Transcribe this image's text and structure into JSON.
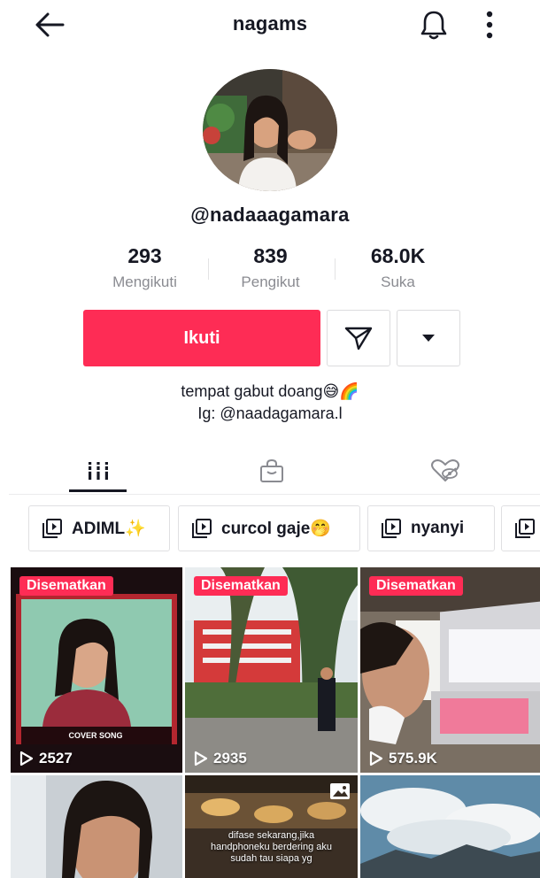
{
  "header": {
    "title": "nagams"
  },
  "profile": {
    "username": "@nadaaagamara",
    "stats": [
      {
        "value": "293",
        "label": "Mengikuti"
      },
      {
        "value": "839",
        "label": "Pengikut"
      },
      {
        "value": "68.0K",
        "label": "Suka"
      }
    ],
    "follow_label": "Ikuti",
    "bio_line1": "tempat gabut doang😅🌈",
    "bio_line2": "Ig: @naadagamara.l"
  },
  "playlists": [
    {
      "label": "ADIML✨"
    },
    {
      "label": "curcol gaje🤭"
    },
    {
      "label": "nyanyi"
    }
  ],
  "videos": [
    {
      "badge": "Disematkan",
      "views": "2527",
      "overlay": "COVER SONG"
    },
    {
      "badge": "Disematkan",
      "views": "2935"
    },
    {
      "badge": "Disematkan",
      "views": "575.9K"
    },
    {},
    {
      "caption": "difase sekarang,jika handphoneku berdering aku sudah tau siapa yg"
    },
    {}
  ],
  "colors": {
    "accent": "#fe2c55",
    "text": "#161823",
    "muted": "#8a8b91"
  },
  "icons": [
    "back-arrow-icon",
    "bell-icon",
    "more-vertical-icon",
    "send-icon",
    "caret-down-icon",
    "grid-icon",
    "shop-bag-icon",
    "liked-hidden-icon",
    "playlist-icon",
    "play-icon",
    "photo-icon"
  ]
}
